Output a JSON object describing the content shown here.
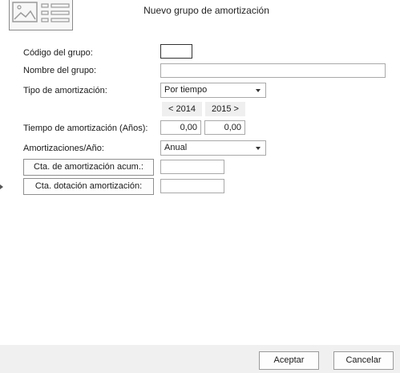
{
  "dialog": {
    "title": "Nuevo grupo de amortización"
  },
  "form": {
    "codigo": {
      "label": "Código del grupo:",
      "value": ""
    },
    "nombre": {
      "label": "Nombre del grupo:",
      "value": ""
    },
    "tipo": {
      "label": "Tipo de amortización:",
      "value": "Por tiempo"
    },
    "years": {
      "prev": "< 2014",
      "next": "2015 >"
    },
    "tiempo": {
      "label": "Tiempo de amortización (Años):",
      "value_2014": "0,00",
      "value_2015": "0,00"
    },
    "amort_anio": {
      "label": "Amortizaciones/Año:",
      "value": "Anual"
    },
    "cta_acum": {
      "label": "Cta. de amortización acum.:",
      "value": ""
    },
    "cta_dotacion": {
      "label": "Cta. dotación amortización:",
      "value": ""
    }
  },
  "footer": {
    "accept": "Aceptar",
    "cancel": "Cancelar"
  },
  "icons": {
    "header": "image-form-icon",
    "dropdown": "chevron-down-icon",
    "marker": "triangle-right-icon"
  }
}
